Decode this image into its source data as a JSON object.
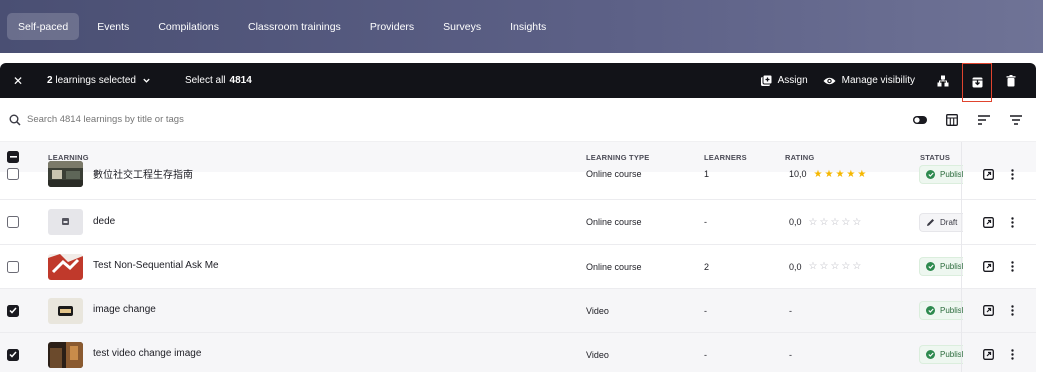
{
  "nav": {
    "tabs": [
      {
        "label": "Self-paced",
        "active": true
      },
      {
        "label": "Events",
        "active": false
      },
      {
        "label": "Compilations",
        "active": false
      },
      {
        "label": "Classroom trainings",
        "active": false
      },
      {
        "label": "Providers",
        "active": false
      },
      {
        "label": "Surveys",
        "active": false
      },
      {
        "label": "Insights",
        "active": false
      }
    ]
  },
  "selection_bar": {
    "close_icon": "close-icon",
    "count": "2",
    "count_suffix": "learnings selected",
    "select_all_label": "Select all",
    "select_all_count": "4814",
    "assign_label": "Assign",
    "visibility_label": "Manage visibility"
  },
  "search": {
    "placeholder": "Search 4814 learnings by title or tags"
  },
  "table": {
    "headers": {
      "learning": "LEARNING",
      "type": "LEARNING TYPE",
      "learners": "LEARNERS",
      "rating": "RATING",
      "status": "STATUS"
    },
    "rows": [
      {
        "title": "數位社交工程生存指南",
        "type": "Online course",
        "learners": "1",
        "rating": "10,0",
        "stars": "★★★★★",
        "stars_style": "filled",
        "status": "Published",
        "status_kind": "published",
        "checked": false
      },
      {
        "title": "dede",
        "type": "Online course",
        "learners": "-",
        "rating": "0,0",
        "stars": "☆☆☆☆☆",
        "stars_style": "empty",
        "status": "Draft",
        "status_kind": "draft",
        "checked": false
      },
      {
        "title": "Test Non-Sequential Ask Me",
        "type": "Online course",
        "learners": "2",
        "rating": "0,0",
        "stars": "☆☆☆☆☆",
        "stars_style": "empty",
        "status": "Published",
        "status_kind": "published",
        "checked": false
      },
      {
        "title": "image change",
        "type": "Video",
        "learners": "-",
        "rating": "-",
        "stars": "",
        "stars_style": "none",
        "status": "Published",
        "status_kind": "published",
        "checked": true
      },
      {
        "title": "test video change image",
        "type": "Video",
        "learners": "-",
        "rating": "-",
        "stars": "",
        "stars_style": "none",
        "status": "Published",
        "status_kind": "published",
        "checked": true
      }
    ]
  },
  "colors": {
    "nav_bg": "#5d6187",
    "selection_bar_bg": "#121318",
    "highlight_border": "#e0442e",
    "star": "#f5b700",
    "published_green": "#2d8a4e"
  }
}
